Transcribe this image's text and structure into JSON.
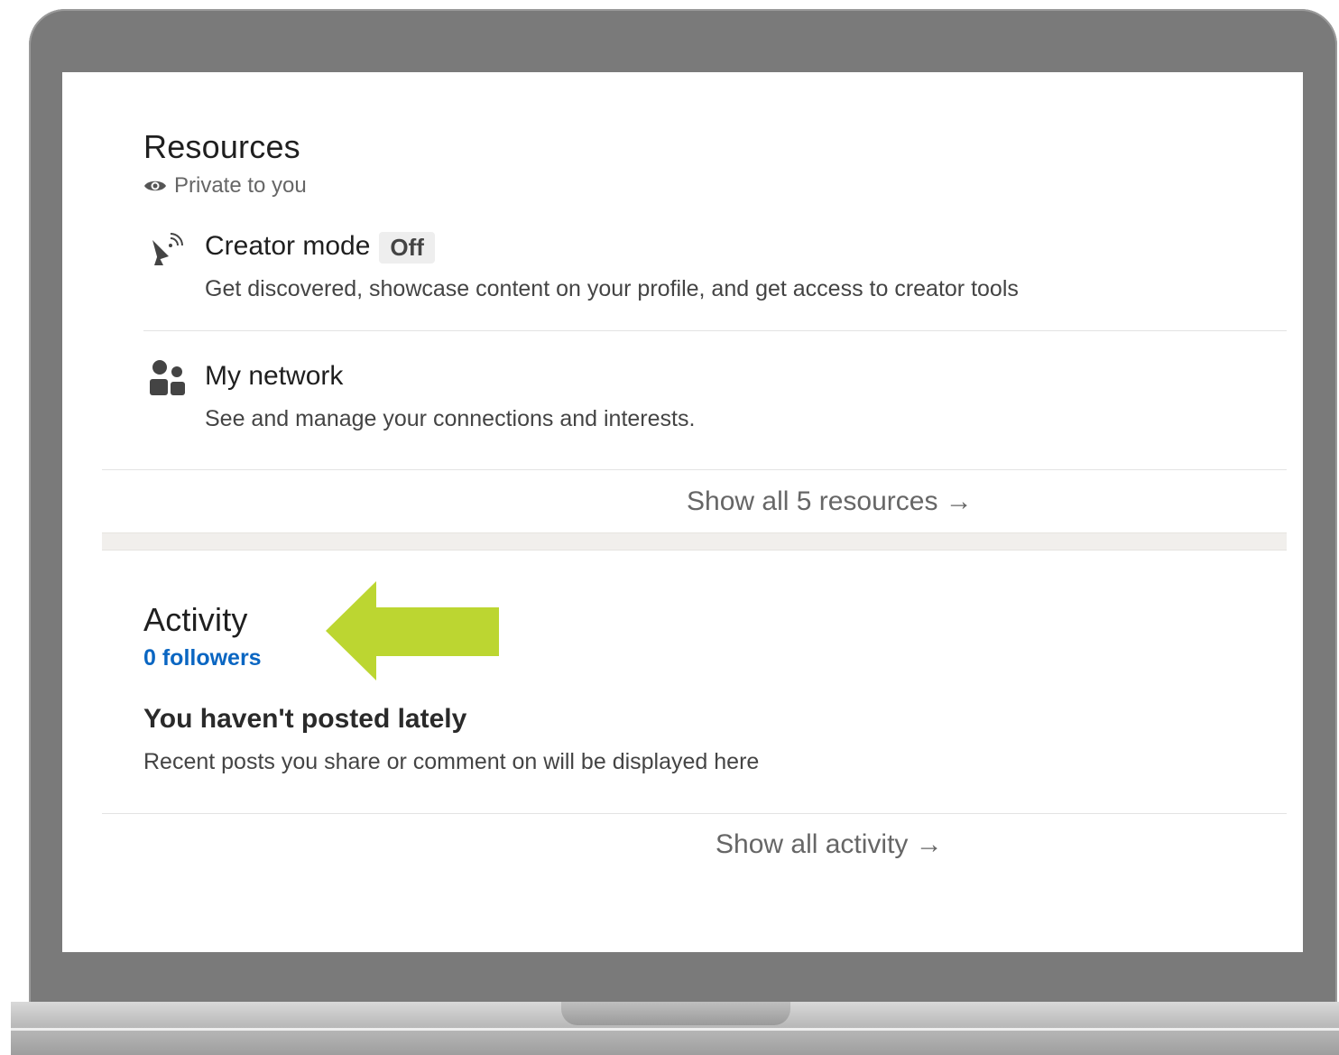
{
  "resources": {
    "title": "Resources",
    "privacy": "Private to you",
    "items": [
      {
        "title": "Creator mode",
        "badge": "Off",
        "description": "Get discovered, showcase content on your profile, and get access to creator tools",
        "icon": "satellite-dish-icon"
      },
      {
        "title": "My network",
        "description": "See and manage your connections and interests.",
        "icon": "people-icon"
      }
    ],
    "show_all": "Show all 5 resources →"
  },
  "activity": {
    "title": "Activity",
    "followers": "0 followers",
    "empty_title": "You haven't posted lately",
    "empty_desc": "Recent posts you share or comment on will be displayed here",
    "show_all": "Show all activity →"
  },
  "annotation": {
    "arrow_color": "#bcd631"
  },
  "colors": {
    "link": "#0a66c2",
    "frame": "#7a7a7a"
  }
}
